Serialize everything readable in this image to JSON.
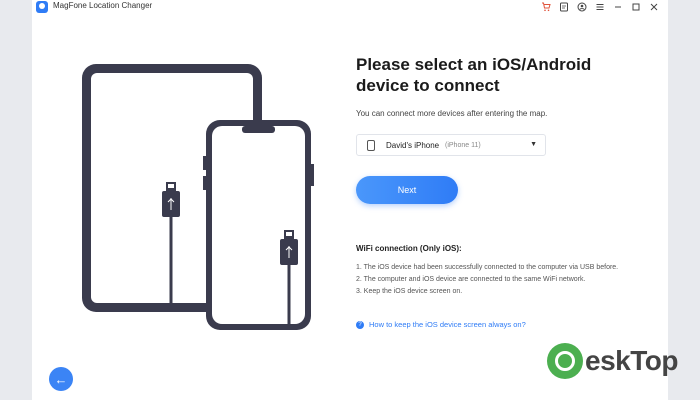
{
  "window": {
    "app_title": "MagFone Location Changer"
  },
  "title_controls": [
    "cart-icon",
    "register-icon",
    "account-icon",
    "menu-icon",
    "minimize-icon",
    "maximize-icon",
    "close-icon"
  ],
  "main": {
    "heading": "Please select an iOS/Android device to connect",
    "subtext": "You can connect more devices after entering the map.",
    "device": {
      "name": "David's iPhone",
      "model": "(iPhone 11)"
    },
    "next_label": "Next",
    "wifi": {
      "title": "WiFi connection (Only iOS):",
      "steps": [
        "1. The iOS device had been successfully connected to the computer via USB before.",
        "2. The computer and iOS device are connected to the same WiFi network.",
        "3. Keep the iOS device screen on."
      ]
    },
    "help_link": "How to keep the iOS device screen always on?"
  },
  "watermark": {
    "text": "eskTop"
  },
  "colors": {
    "accent": "#2f7cf6",
    "device_frame": "#3a3b4d",
    "watermark_green": "#4caf50"
  }
}
